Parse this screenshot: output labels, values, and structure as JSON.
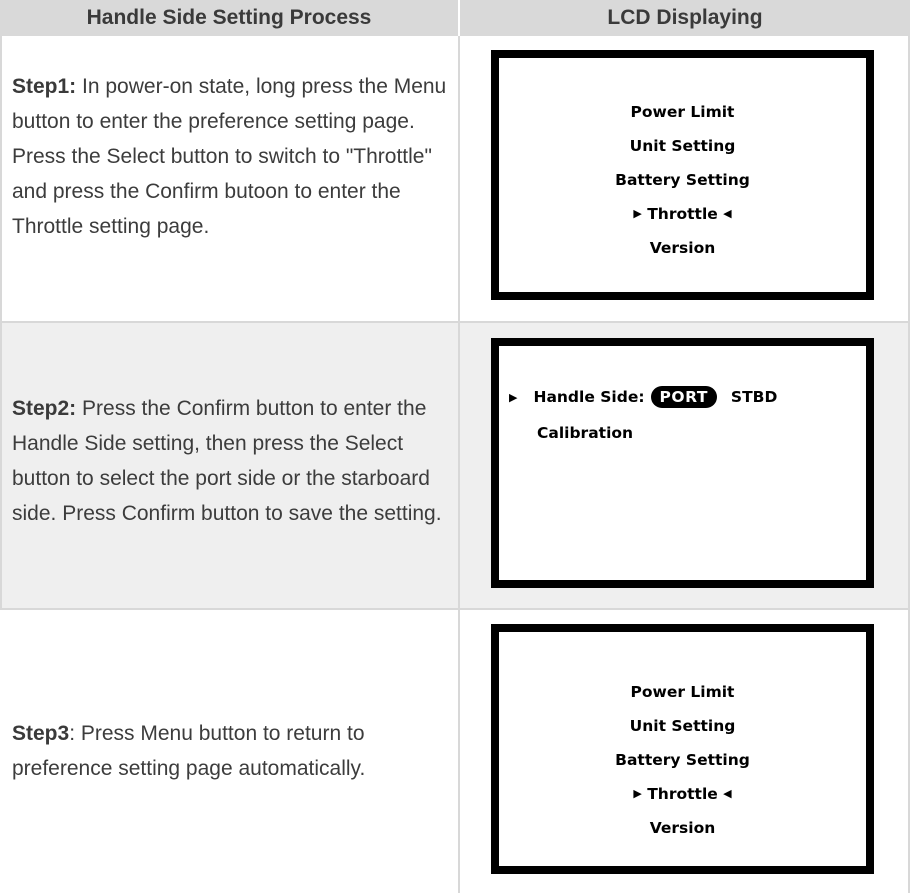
{
  "header": {
    "left": "Handle Side Setting Process",
    "right": "LCD Displaying"
  },
  "steps": [
    {
      "label": "Step1:",
      "text": "In power-on state, long press the Menu button to enter the preference setting page. Press the Select button to switch to \"Throttle\" and press the Confirm butoon to enter the Throttle setting page."
    },
    {
      "label": "Step2:",
      "text": "Press the Confirm button to enter the Handle Side setting, then press the Select button to select the port side or the starboard side. Press Confirm button to save the setting."
    },
    {
      "label": "Step3",
      "text": ": Press Menu button to return to preference setting page automatically."
    }
  ],
  "lcd1": {
    "items": [
      "Power Limit",
      "Unit Setting",
      "Battery Setting",
      "Throttle",
      "Version"
    ]
  },
  "lcd2": {
    "handle_label": "Handle Side:",
    "selected_option": "PORT",
    "other_option": "STBD",
    "calibration": "Calibration"
  },
  "lcd3": {
    "items": [
      "Power Limit",
      "Unit Setting",
      "Battery Setting",
      "Throttle",
      "Version"
    ]
  }
}
